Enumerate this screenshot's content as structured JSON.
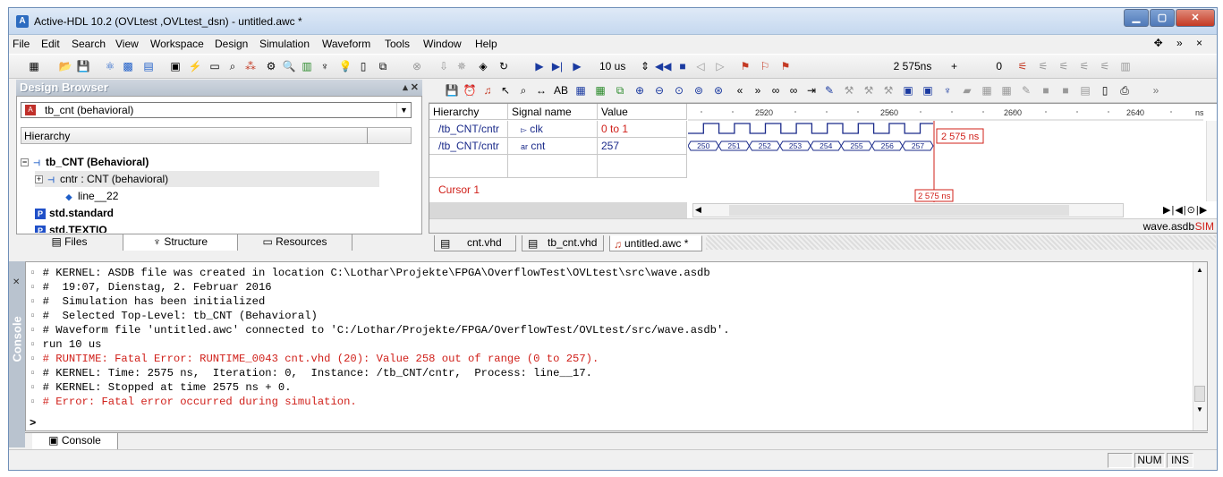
{
  "window": {
    "title": "Active-HDL 10.2 (OVLtest ,OVLtest_dsn) - untitled.awc *",
    "app_icon": "A",
    "controls": {
      "minimize": "▁",
      "maximize": "▢",
      "close": "✕"
    }
  },
  "menu": [
    "File",
    "Edit",
    "Search",
    "View",
    "Workspace",
    "Design",
    "Simulation",
    "Waveform",
    "Tools",
    "Window",
    "Help"
  ],
  "menu_right": "✥ » ×",
  "toolbar": {
    "run_for": "10 us",
    "sim_time": "2 575ns",
    "plus": "+",
    "delta": "0"
  },
  "design_browser": {
    "title": "Design Browser",
    "controls": "▴ ✕",
    "top_level": "tb_cnt (behavioral)",
    "hierarchy_header": "Hierarchy",
    "tree": [
      {
        "label": "tb_CNT (Behavioral)",
        "expander": "−"
      },
      {
        "label": "cntr : CNT (behavioral)",
        "expander": "+"
      },
      {
        "label": "line__22"
      },
      {
        "label": "std.standard"
      },
      {
        "label": "std.TEXTIO"
      }
    ],
    "tabs": [
      "Files",
      "Structure",
      "Resources"
    ]
  },
  "waveform": {
    "columns": [
      "Hierarchy",
      "Signal name",
      "Value"
    ],
    "rows": [
      {
        "hierarchy": "/tb_CNT/cntr",
        "signal": "clk",
        "signal_prefix": "▻",
        "value": "0 to 1"
      },
      {
        "hierarchy": "/tb_CNT/cntr",
        "signal": "cnt",
        "signal_prefix": "ar",
        "value": "257"
      }
    ],
    "cursor_label": "Cursor 1",
    "cursor_time": "2 575 ns",
    "ruler_ticks": [
      "2520",
      "2560",
      "2600",
      "2640",
      "ns"
    ],
    "cnt_values": [
      "250",
      "251",
      "252",
      "253",
      "254",
      "255",
      "256",
      "257"
    ],
    "db_name": "wave.asdb",
    "sim_tag": "SIM",
    "doc_tabs": [
      "cnt.vhd",
      "tb_cnt.vhd",
      "untitled.awc *"
    ]
  },
  "console": {
    "side_title": "Console",
    "lines": [
      {
        "text": "# KERNEL: ASDB file was created in location C:\\Lothar\\Projekte\\FPGA\\OverflowTest\\OVLtest\\src\\wave.asdb",
        "error": false
      },
      {
        "text": "#  19:07, Dienstag, 2. Februar 2016",
        "error": false
      },
      {
        "text": "#  Simulation has been initialized",
        "error": false
      },
      {
        "text": "#  Selected Top-Level: tb_CNT (Behavioral)",
        "error": false
      },
      {
        "text": "# Waveform file 'untitled.awc' connected to 'C:/Lothar/Projekte/FPGA/OverflowTest/OVLtest/src/wave.asdb'.",
        "error": false
      },
      {
        "text": "run 10 us",
        "error": false
      },
      {
        "text": "# RUNTIME: Fatal Error: RUNTIME_0043 cnt.vhd (20): Value 258 out of range (0 to 257).",
        "error": true
      },
      {
        "text": "# KERNEL: Time: 2575 ns,  Iteration: 0,  Instance: /tb_CNT/cntr,  Process: line__17.",
        "error": false
      },
      {
        "text": "# KERNEL: Stopped at time 2575 ns + 0.",
        "error": false
      },
      {
        "text": "# Error: Fatal error occurred during simulation.",
        "error": true
      }
    ],
    "prompt": ">",
    "tab": "Console",
    "colors": {
      "error": "#d0201a"
    }
  },
  "status": {
    "num": "NUM",
    "ins": "INS"
  }
}
